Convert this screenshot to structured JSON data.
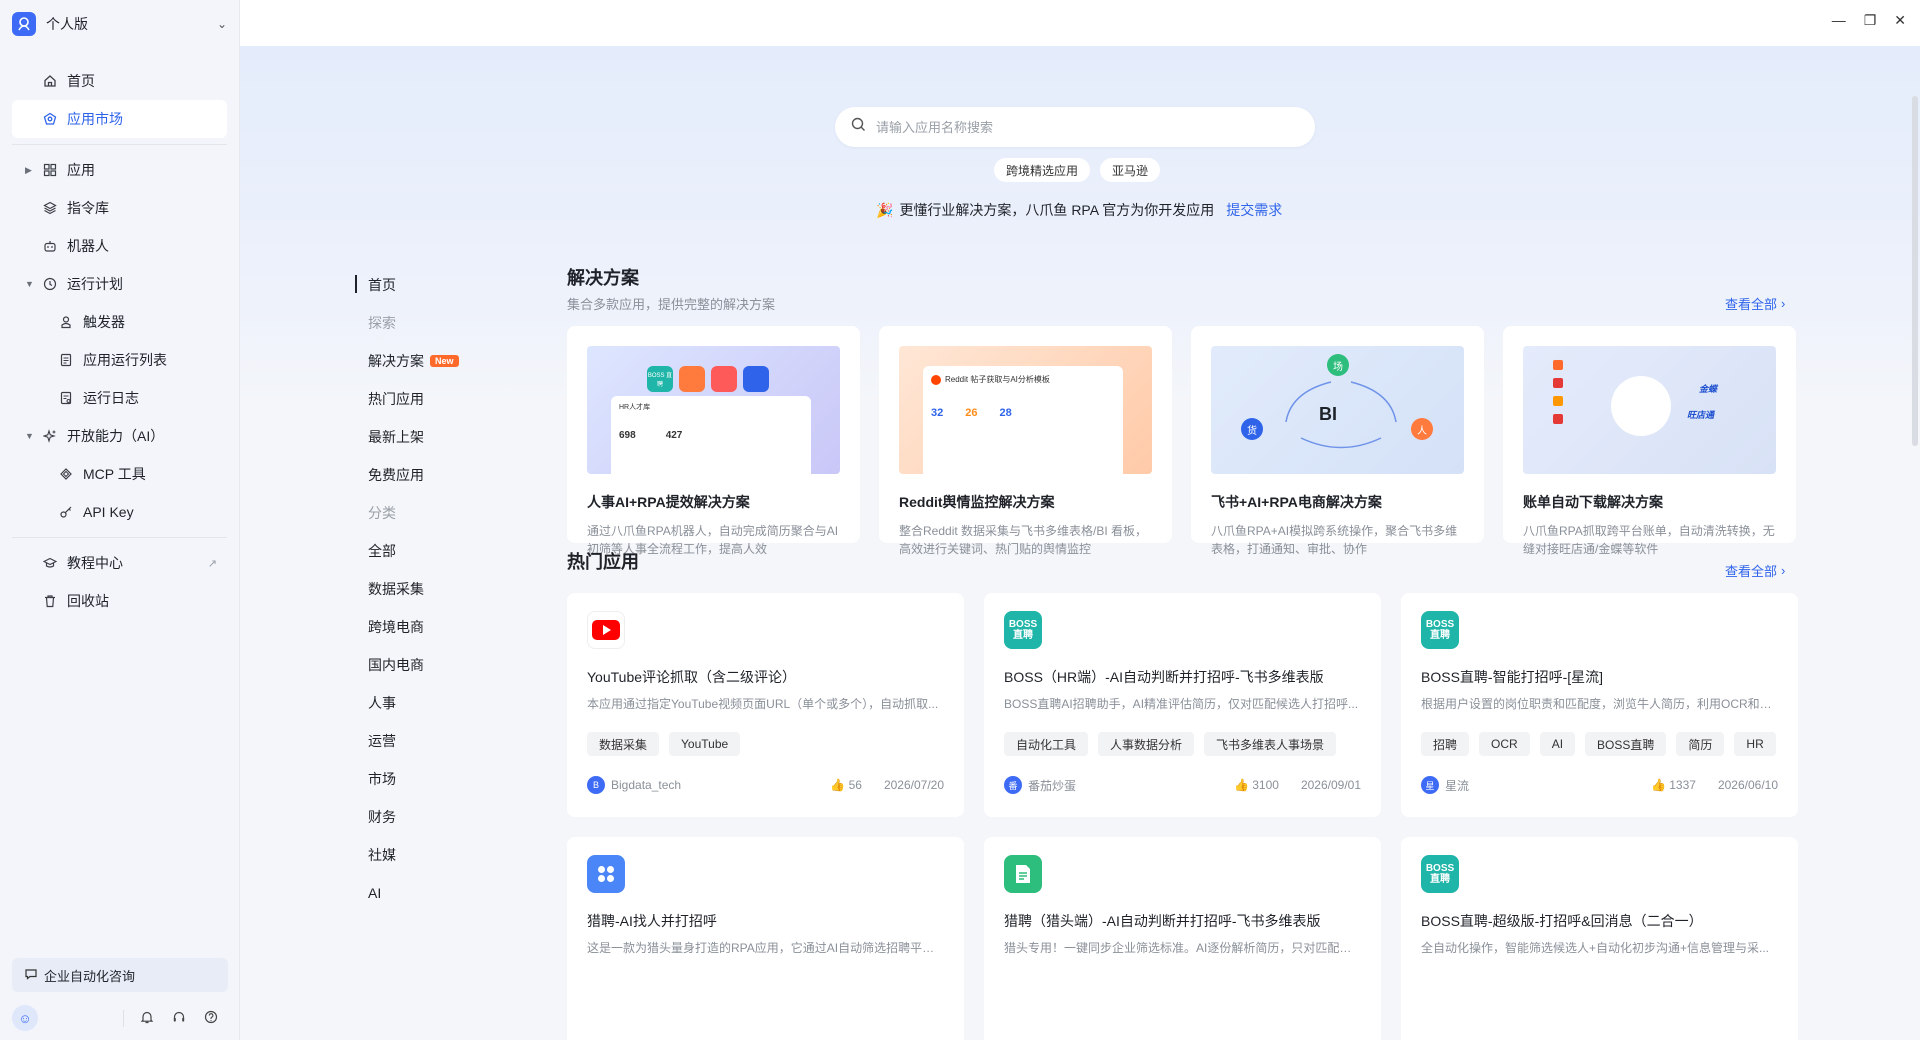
{
  "sidebar": {
    "workspace": "个人版",
    "items": [
      {
        "label": "首页",
        "icon": "home-icon"
      },
      {
        "label": "应用市场",
        "icon": "market-icon"
      },
      {
        "label": "应用",
        "icon": "grid-icon"
      },
      {
        "label": "指令库",
        "icon": "layers-icon"
      },
      {
        "label": "机器人",
        "icon": "robot-icon"
      },
      {
        "label": "运行计划",
        "icon": "clock-icon"
      },
      {
        "label": "触发器",
        "icon": "trigger-icon"
      },
      {
        "label": "应用运行列表",
        "icon": "list-icon"
      },
      {
        "label": "运行日志",
        "icon": "log-icon"
      },
      {
        "label": "开放能力（AI）",
        "icon": "sparkle-icon"
      },
      {
        "label": "MCP 工具",
        "icon": "mcp-icon"
      },
      {
        "label": "API Key",
        "icon": "key-icon"
      },
      {
        "label": "教程中心",
        "icon": "graduation-icon"
      },
      {
        "label": "回收站",
        "icon": "trash-icon"
      }
    ],
    "consult": "企业自动化咨询"
  },
  "search": {
    "placeholder": "请输入应用名称搜索",
    "chips": [
      "跨境精选应用",
      "亚马逊"
    ]
  },
  "banner": {
    "text": "更懂行业解决方案，八爪鱼 RPA 官方为你开发应用",
    "link": "提交需求"
  },
  "categories": {
    "items": [
      "首页",
      "探索",
      "解决方案",
      "热门应用",
      "最新上架",
      "免费应用",
      "分类",
      "全部",
      "数据采集",
      "跨境电商",
      "国内电商",
      "人事",
      "运营",
      "市场",
      "财务",
      "社媒",
      "AI"
    ],
    "new_badge": "New"
  },
  "solutions": {
    "title": "解决方案",
    "subtitle": "集合多款应用，提供完整的解决方案",
    "view_all": "查看全部",
    "cards": [
      {
        "title": "人事AI+RPA提效解决方案",
        "desc": "通过八爪鱼RPA机器人，自动完成简历聚合与AI初筛等人事全流程工作，提高人效",
        "img_nums": [
          "698",
          "427"
        ],
        "img_label": "HR人才库",
        "img_badge": "BOSS 直聘"
      },
      {
        "title": "Reddit舆情监控解决方案",
        "desc": "整合Reddit 数据采集与飞书多维表格/BI 看板，高效进行关键词、热门贴的舆情监控",
        "img_nums": [
          "32",
          "26",
          "28"
        ],
        "img_label": "Reddit 帖子获取与AI分析模板"
      },
      {
        "title": "飞书+AI+RPA电商解决方案",
        "desc": "八爪鱼RPA+AI模拟跨系统操作，聚合飞书多维表格，打通通知、审批、协作",
        "img_labels": [
          "场",
          "BI",
          "货",
          "人"
        ]
      },
      {
        "title": "账单自动下载解决方案",
        "desc": "八爪鱼RPA抓取跨平台账单，自动清洗转换，无缝对接旺店通/金蝶等软件",
        "img_labels": [
          "金蝶",
          "旺店通"
        ]
      }
    ]
  },
  "hot": {
    "title": "热门应用",
    "view_all": "查看全部",
    "cards": [
      {
        "title": "YouTube评论抓取（含二级评论）",
        "desc": "本应用通过指定YouTube视频页面URL（单个或多个），自动抓取...",
        "tags": [
          "数据采集",
          "YouTube"
        ],
        "author": "Bigdata_tech",
        "author_initial": "B",
        "likes": "56",
        "date": "2026/07/20",
        "icon": "youtube-icon"
      },
      {
        "title": "BOSS（HR端）-AI自动判断并打招呼-飞书多维表版",
        "desc": "BOSS直聘AI招聘助手，AI精准评估简历，仅对匹配候选人打招呼...",
        "tags": [
          "自动化工具",
          "人事数据分析",
          "飞书多维表人事场景"
        ],
        "author": "番茄炒蛋",
        "author_initial": "番",
        "likes": "3100",
        "date": "2026/09/01",
        "icon": "boss-icon",
        "icon_text": "BOSS 直聘"
      },
      {
        "title": "BOSS直聘-智能打招呼-[星流]",
        "desc": "根据用户设置的岗位职责和匹配度，浏览牛人简历，利用OCR和AI...",
        "tags": [
          "招聘",
          "OCR",
          "AI",
          "BOSS直聘",
          "简历",
          "HR"
        ],
        "author": "星流",
        "author_initial": "星",
        "likes": "1337",
        "date": "2026/06/10",
        "icon": "boss-icon",
        "icon_text": "BOSS 直聘"
      },
      {
        "title": "猎聘-AI找人并打招呼",
        "desc": "这是一款为猎头量身打造的RPA应用，它通过AI自动筛选招聘平台...",
        "icon": "apps-icon"
      },
      {
        "title": "猎聘（猎头端）-AI自动判断并打招呼-飞书多维表版",
        "desc": "猎头专用！一键同步企业筛选标准。AI逐份解析简历，只对匹配目...",
        "icon": "doc-icon"
      },
      {
        "title": "BOSS直聘-超级版-打招呼&回消息（二合一）",
        "desc": "全自动化操作，智能筛选候选人+自动化初步沟通+信息管理与采...",
        "icon": "boss-icon",
        "icon_text": "BOSS 直聘"
      }
    ]
  },
  "colors": {
    "accent": "#2f64ea",
    "new": "#ff6a2b",
    "boss": "#1fb5a8"
  }
}
